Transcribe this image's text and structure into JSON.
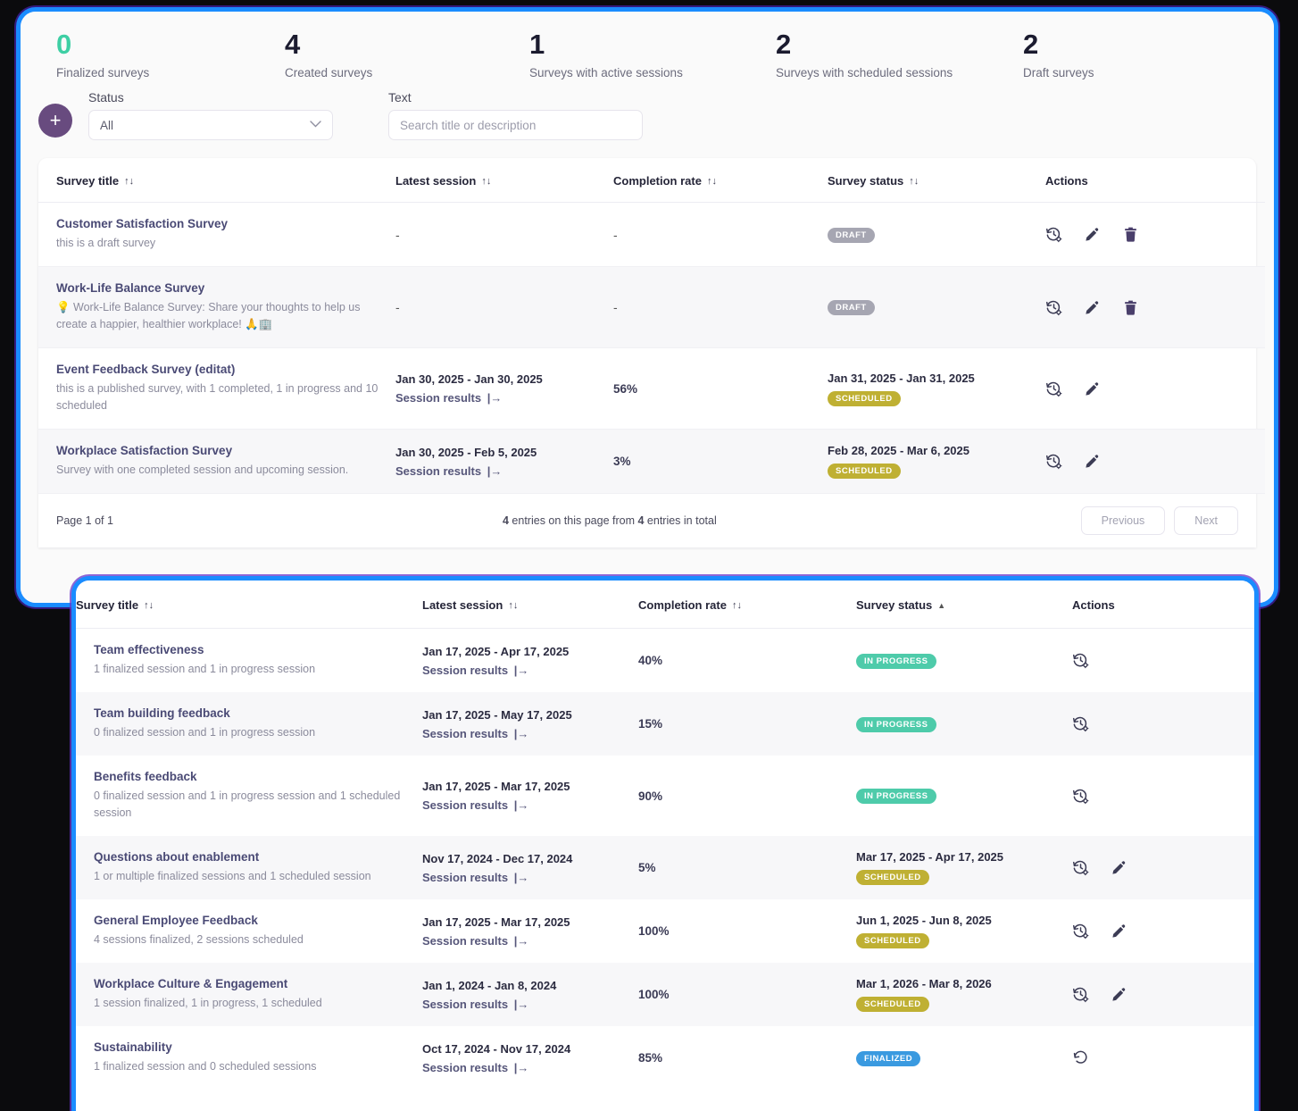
{
  "stats": [
    {
      "value": "0",
      "label": "Finalized surveys",
      "accent": true
    },
    {
      "value": "4",
      "label": "Created surveys",
      "accent": false
    },
    {
      "value": "1",
      "label": "Surveys with active sessions",
      "accent": false
    },
    {
      "value": "2",
      "label": "Surveys with scheduled sessions",
      "accent": false
    },
    {
      "value": "2",
      "label": "Draft surveys",
      "accent": false
    }
  ],
  "filters": {
    "add_button_label": "+",
    "status_label": "Status",
    "status_value": "All",
    "status_options": [
      "All"
    ],
    "text_label": "Text",
    "text_value": "",
    "text_placeholder": "Search title or description"
  },
  "colors": {
    "frame_blue": "#1a8cff",
    "frame_purple": "#6932c8",
    "accent_green": "#3ecfa4",
    "fab_purple": "#684b7f",
    "badge_draft": "#a6a6b2",
    "badge_scheduled": "#bfb033",
    "badge_in_progress": "#4ecbaa",
    "badge_finalized": "#3a9ae0"
  },
  "table_top": {
    "columns": [
      {
        "label": "Survey title",
        "sort": "both"
      },
      {
        "label": "Latest session",
        "sort": "both"
      },
      {
        "label": "Completion rate",
        "sort": "both"
      },
      {
        "label": "Survey status",
        "sort": "both"
      },
      {
        "label": "Actions",
        "sort": "none"
      }
    ],
    "session_results_label": "Session results",
    "rows": [
      {
        "title": "Customer Satisfaction Survey",
        "desc": "this is a draft survey",
        "session_dates": "-",
        "has_session_link": false,
        "completion": "-",
        "status_dates": "",
        "status_badge": "DRAFT",
        "status_kind": "draft",
        "actions": [
          "history-settings-icon",
          "edit-icon",
          "delete-icon"
        ]
      },
      {
        "title": "Work-Life Balance Survey",
        "desc": "💡 Work-Life Balance Survey: Share your thoughts to help us create a happier, healthier workplace! 🙏🏢",
        "session_dates": "-",
        "has_session_link": false,
        "completion": "-",
        "status_dates": "",
        "status_badge": "DRAFT",
        "status_kind": "draft",
        "actions": [
          "history-settings-icon",
          "edit-icon",
          "delete-icon"
        ]
      },
      {
        "title": "Event Feedback Survey (editat)",
        "desc": "this is a published survey, with 1 completed, 1 in progress and 10 scheduled",
        "session_dates": "Jan 30, 2025 - Jan 30, 2025",
        "has_session_link": true,
        "completion": "56%",
        "status_dates": "Jan 31, 2025 - Jan 31, 2025",
        "status_badge": "SCHEDULED",
        "status_kind": "scheduled",
        "actions": [
          "history-settings-icon",
          "edit-icon"
        ]
      },
      {
        "title": "Workplace Satisfaction Survey",
        "desc": "Survey with one completed session and upcoming session.",
        "session_dates": "Jan 30, 2025 - Feb 5, 2025",
        "has_session_link": true,
        "completion": "3%",
        "status_dates": "Feb 28, 2025 - Mar 6, 2025",
        "status_badge": "SCHEDULED",
        "status_kind": "scheduled",
        "actions": [
          "history-settings-icon",
          "edit-icon"
        ]
      }
    ],
    "pagination": {
      "page_info": "Page 1 of 1",
      "entries_count": "4",
      "entries_total": "4",
      "entries_text_mid": " entries on this page from ",
      "entries_text_end": " entries in total",
      "previous_label": "Previous",
      "next_label": "Next"
    }
  },
  "table_overlay": {
    "columns": [
      {
        "label": "Survey title",
        "sort": "both"
      },
      {
        "label": "Latest session",
        "sort": "both"
      },
      {
        "label": "Completion rate",
        "sort": "both"
      },
      {
        "label": "Survey status",
        "sort": "asc"
      },
      {
        "label": "Actions",
        "sort": "none"
      }
    ],
    "session_results_label": "Session results",
    "rows": [
      {
        "title": "Team effectiveness",
        "desc": "1 finalized session and 1 in progress session",
        "session_dates": "Jan 17, 2025 - Apr 17, 2025",
        "has_session_link": true,
        "completion": "40%",
        "status_dates": "",
        "status_badge": "IN PROGRESS",
        "status_kind": "inprogress",
        "actions": [
          "history-settings-icon"
        ]
      },
      {
        "title": "Team building feedback",
        "desc": "0 finalized session and 1 in progress session",
        "session_dates": "Jan 17, 2025 - May 17, 2025",
        "has_session_link": true,
        "completion": "15%",
        "status_dates": "",
        "status_badge": "IN PROGRESS",
        "status_kind": "inprogress",
        "actions": [
          "history-settings-icon"
        ]
      },
      {
        "title": "Benefits feedback",
        "desc": "0 finalized session and 1 in progress session and 1 scheduled session",
        "session_dates": "Jan 17, 2025 - Mar 17, 2025",
        "has_session_link": true,
        "completion": "90%",
        "status_dates": "",
        "status_badge": "IN PROGRESS",
        "status_kind": "inprogress",
        "actions": [
          "history-settings-icon"
        ]
      },
      {
        "title": "Questions about enablement",
        "desc": "1 or multiple finalized sessions and 1 scheduled session",
        "session_dates": "Nov 17, 2024 - Dec 17, 2024",
        "has_session_link": true,
        "completion": "5%",
        "status_dates": "Mar 17, 2025 - Apr 17, 2025",
        "status_badge": "SCHEDULED",
        "status_kind": "scheduled",
        "actions": [
          "history-settings-icon",
          "edit-icon"
        ]
      },
      {
        "title": "General Employee Feedback",
        "desc": "4 sessions finalized, 2 sessions scheduled",
        "session_dates": "Jan 17, 2025 - Mar 17, 2025",
        "has_session_link": true,
        "completion": "100%",
        "status_dates": "Jun 1, 2025 - Jun 8, 2025",
        "status_badge": "SCHEDULED",
        "status_kind": "scheduled",
        "actions": [
          "history-settings-icon",
          "edit-icon"
        ]
      },
      {
        "title": "Workplace Culture & Engagement",
        "desc": "1 session finalized, 1 in progress, 1 scheduled",
        "session_dates": "Jan 1, 2024 - Jan 8, 2024",
        "has_session_link": true,
        "completion": "100%",
        "status_dates": "Mar 1, 2026 - Mar 8, 2026",
        "status_badge": "SCHEDULED",
        "status_kind": "scheduled",
        "actions": [
          "history-settings-icon",
          "edit-icon"
        ]
      },
      {
        "title": "Sustainability",
        "desc": "1 finalized session and 0 scheduled sessions",
        "session_dates": "Oct 17, 2024 - Nov 17, 2024",
        "has_session_link": true,
        "completion": "85%",
        "status_dates": "",
        "status_badge": "FINALIZED",
        "status_kind": "finalized",
        "actions": [
          "restore-icon"
        ]
      }
    ]
  }
}
